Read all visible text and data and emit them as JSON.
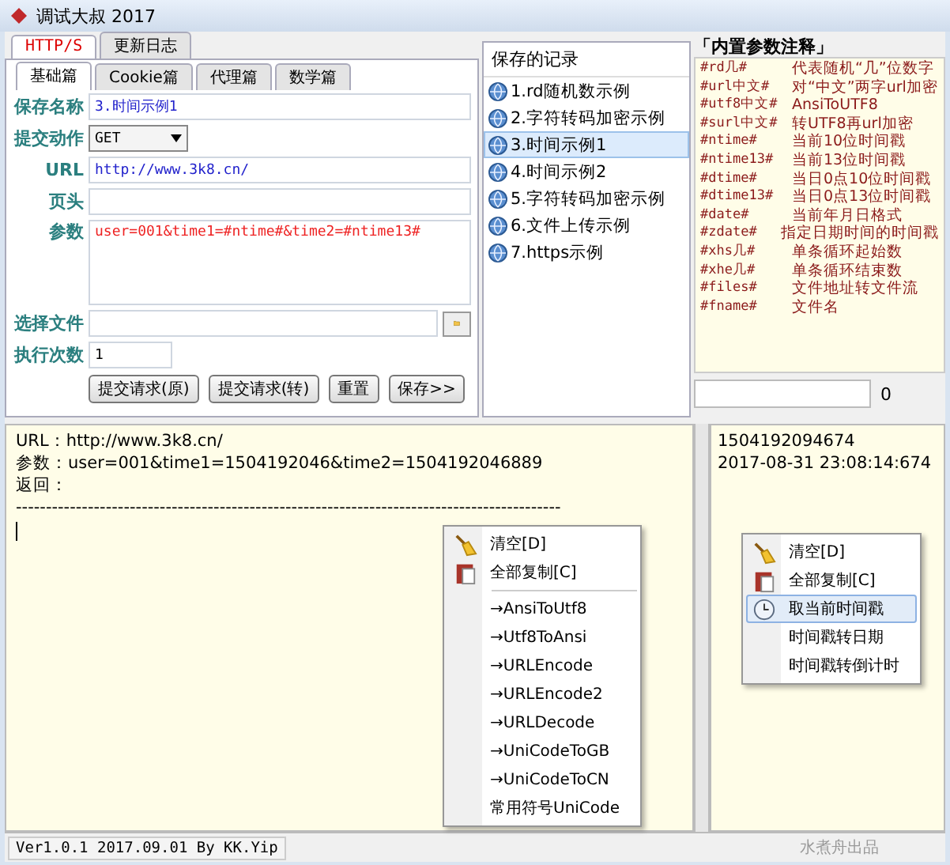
{
  "window": {
    "title": "调试大叔 2017"
  },
  "outer_tabs": [
    {
      "label": "HTTP/S",
      "selected": true
    },
    {
      "label": "更新日志",
      "selected": false
    }
  ],
  "inner_tabs": [
    {
      "label": "基础篇",
      "selected": true
    },
    {
      "label": "Cookie篇",
      "selected": false
    },
    {
      "label": "代理篇",
      "selected": false
    },
    {
      "label": "数学篇",
      "selected": false
    }
  ],
  "form": {
    "fields": [
      {
        "label": "保存名称",
        "kind": "text",
        "value": "3.时间示例1"
      },
      {
        "label": "提交动作",
        "kind": "select",
        "value": "GET"
      },
      {
        "label": "URL",
        "kind": "link",
        "value": "http://www.3k8.cn/"
      },
      {
        "label": "页头",
        "kind": "text"
      },
      {
        "label": "参数",
        "kind": "textarea",
        "value": "user=001&time1=#ntime#&time2=#ntime13#"
      },
      {
        "label": "选择文件",
        "kind": "file"
      },
      {
        "label": "执行次数",
        "kind": "short",
        "value": "1"
      }
    ],
    "buttons": [
      "提交请求(原)",
      "提交请求(转)",
      "重置",
      "保存>>"
    ]
  },
  "saved_records": {
    "title": "保存的记录",
    "items": [
      {
        "label": "1.rd随机数示例",
        "selected": false
      },
      {
        "label": "2.字符转码加密示例",
        "selected": false
      },
      {
        "label": "3.时间示例1",
        "selected": true
      },
      {
        "label": "4.时间示例2",
        "selected": false
      },
      {
        "label": "5.字符转码加密示例",
        "selected": false
      },
      {
        "label": "6.文件上传示例",
        "selected": false
      },
      {
        "label": "7.https示例",
        "selected": false
      }
    ]
  },
  "annotations": {
    "title": "「内置参数注释」",
    "entries": [
      {
        "key": "#rd几#",
        "desc": "代表随机“几”位数字"
      },
      {
        "key": "#url中文#",
        "desc": "对“中文”两字url加密"
      },
      {
        "key": "#utf8中文#",
        "desc": "AnsiToUTF8"
      },
      {
        "key": "#surl中文#",
        "desc": "转UTF8再url加密"
      },
      {
        "key": "#ntime#",
        "desc": "当前10位时间戳"
      },
      {
        "key": "#ntime13#",
        "desc": "当前13位时间戳"
      },
      {
        "key": "#dtime#",
        "desc": "当日0点10位时间戳"
      },
      {
        "key": "#dtime13#",
        "desc": "当日0点13位时间戳"
      },
      {
        "key": "#date#",
        "desc": "当前年月日格式"
      },
      {
        "key": "#zdate#",
        "desc": "指定日期时间的时间戳"
      },
      {
        "key": "#xhs几#",
        "desc": "单条循环起始数"
      },
      {
        "key": "#xhe几#",
        "desc": "单条循环结束数"
      },
      {
        "key": "#files#",
        "desc": "文件地址转文件流"
      },
      {
        "key": "#fname#",
        "desc": "文件名"
      }
    ],
    "counter": "0"
  },
  "output": {
    "lines": [
      "URL：http://www.3k8.cn/",
      "参数：user=001&time1=1504192046&time2=1504192046889",
      "返回：",
      "-------------------------------------------------------------------------------------------"
    ]
  },
  "result": {
    "lines": [
      "1504192094674",
      "2017-08-31 23:08:14:674"
    ]
  },
  "menus": [
    {
      "items": [
        {
          "label": "清空[D]",
          "kind": "broom",
          "selected": false
        },
        {
          "label": "全部复制[C]",
          "kind": "clipboard",
          "selected": false,
          "separator_after": true
        },
        {
          "label": "→AnsiToUtf8",
          "kind": "plain",
          "selected": false
        },
        {
          "label": "→Utf8ToAnsi",
          "kind": "plain",
          "selected": false
        },
        {
          "label": "→URLEncode",
          "kind": "plain",
          "selected": false
        },
        {
          "label": "→URLEncode2",
          "kind": "plain",
          "selected": false
        },
        {
          "label": "→URLDecode",
          "kind": "plain",
          "selected": false
        },
        {
          "label": "→UniCodeToGB",
          "kind": "plain",
          "selected": false
        },
        {
          "label": "→UniCodeToCN",
          "kind": "plain",
          "selected": false
        },
        {
          "label": "常用符号UniCode",
          "kind": "plain",
          "selected": false
        }
      ]
    },
    {
      "items": [
        {
          "label": "清空[D]",
          "kind": "broom",
          "selected": false
        },
        {
          "label": "全部复制[C]",
          "kind": "clipboard",
          "selected": false
        },
        {
          "label": "取当前时间戳",
          "kind": "clock",
          "selected": true
        },
        {
          "label": "时间戳转日期",
          "kind": "plain",
          "selected": false
        },
        {
          "label": "时间戳转倒计时",
          "kind": "plain",
          "selected": false
        }
      ]
    }
  ],
  "status_bar": {
    "version": "Ver1.0.1 2017.09.01 By KK.Yip",
    "credit": "水煮舟出品"
  }
}
